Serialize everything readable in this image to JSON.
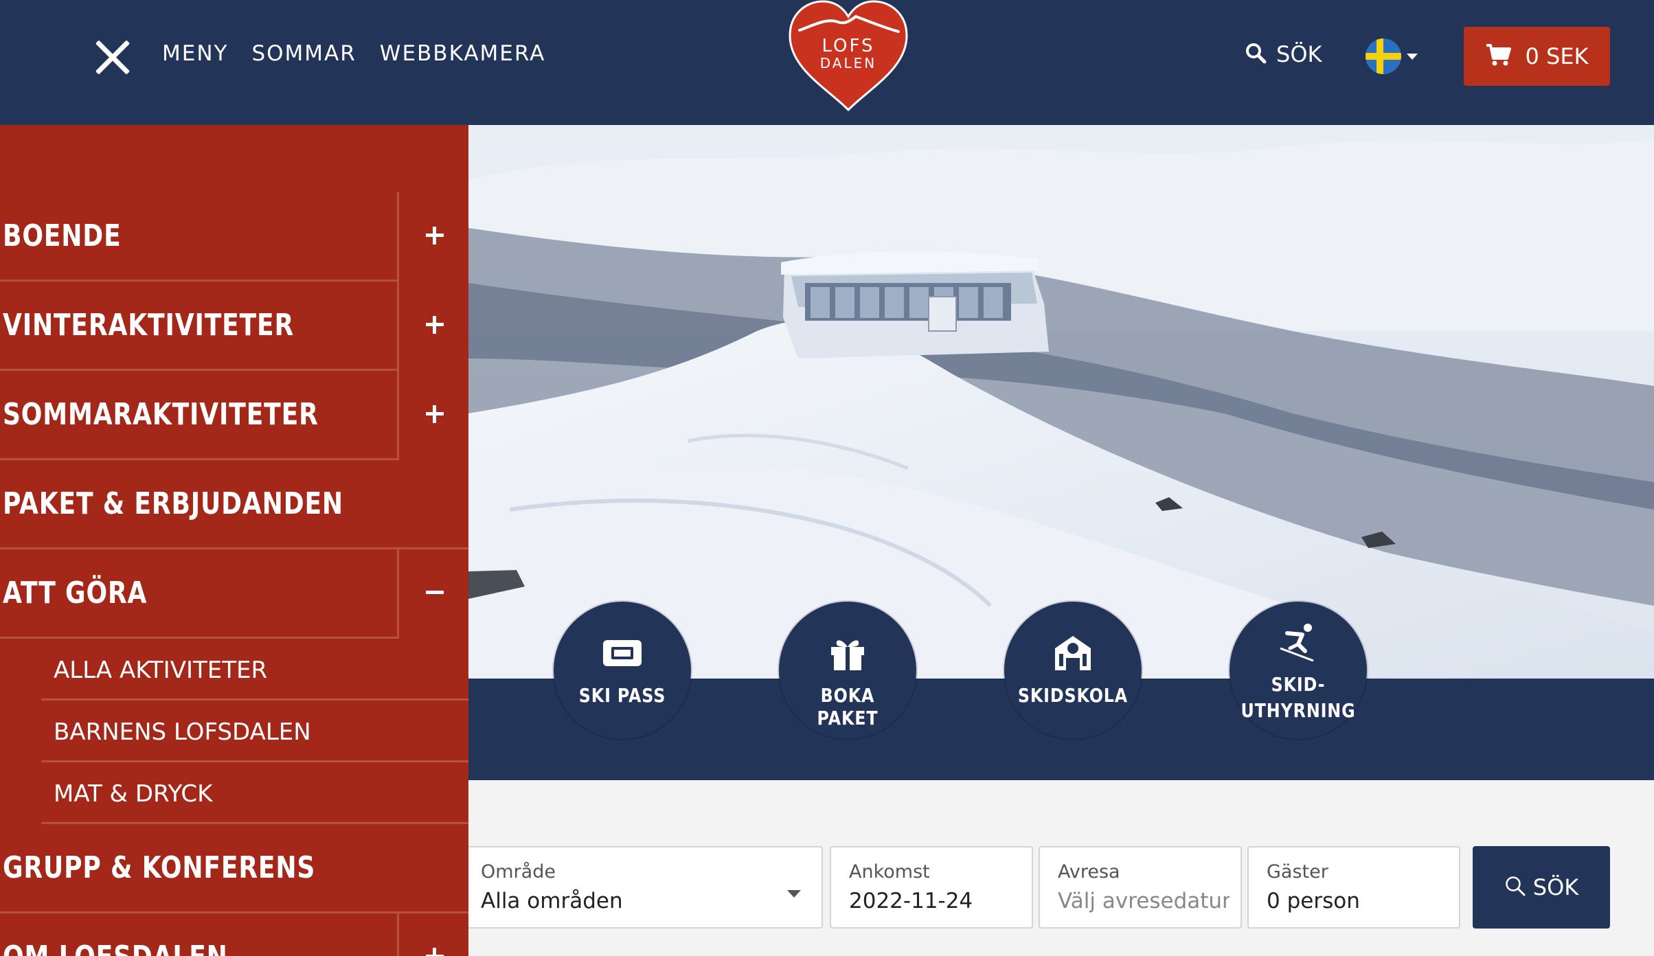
{
  "header": {
    "nav": [
      "MENY",
      "SOMMAR",
      "WEBBKAMERA"
    ],
    "logo_line1": "LOFS",
    "logo_line2": "DALEN",
    "search_label": "SÖK",
    "cart_label": "0 SEK",
    "language": "Svenska"
  },
  "menu": {
    "items": [
      {
        "label": "BOENDE",
        "toggle": "plus"
      },
      {
        "label": "VINTERAKTIVITETER",
        "toggle": "plus"
      },
      {
        "label": "SOMMARAKTIVITETER",
        "toggle": "plus"
      },
      {
        "label": "PAKET & ERBJUDANDEN",
        "toggle": "none"
      },
      {
        "label": "ATT GÖRA",
        "toggle": "minus"
      }
    ],
    "sub_items": [
      "ALLA AKTIVITETER",
      "BARNENS LOFSDALEN",
      "MAT & DRYCK"
    ],
    "more_items": [
      {
        "label": "GRUPP & KONFERENS",
        "toggle": "none"
      },
      {
        "label": "OM LOFSDALEN",
        "toggle": "plus"
      }
    ]
  },
  "quick_links": [
    {
      "label": "SKI PASS",
      "icon": "ticket-icon"
    },
    {
      "label": "BOKA PAKET",
      "icon": "gift-icon"
    },
    {
      "label": "SKIDSKOLA",
      "icon": "school-icon"
    },
    {
      "label": "SKID-",
      "label2": "UTHYRNING",
      "icon": "skier-icon"
    }
  ],
  "booking": {
    "area": {
      "label": "Område",
      "value": "Alla områden"
    },
    "arrival": {
      "label": "Ankomst",
      "value": "2022-11-24"
    },
    "departure": {
      "label": "Avresa",
      "placeholder": "Välj avresedatum"
    },
    "guests": {
      "label": "Gäster",
      "value": "0 person"
    },
    "search_label": "SÖK"
  },
  "colors": {
    "navy": "#233459",
    "red": "#a3281a",
    "cart_red": "#b7311b"
  }
}
